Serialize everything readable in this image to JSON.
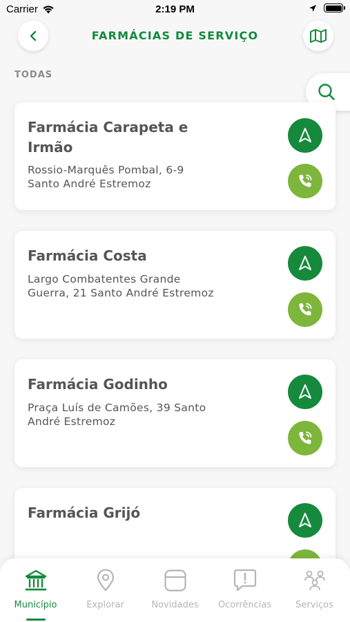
{
  "status_bar": {
    "carrier": "Carrier",
    "time": "2:19 PM"
  },
  "header": {
    "title": "FARMÁCIAS DE SERVIÇO"
  },
  "section": {
    "label": "TODAS"
  },
  "pharmacies": [
    {
      "name": "Farmácia Carapeta e Irmão",
      "address": "Rossio-Marquês Pombal, 6-9 Santo André Estremoz"
    },
    {
      "name": "Farmácia Costa",
      "address": "Largo Combatentes Grande Guerra, 21 Santo André Estremoz"
    },
    {
      "name": "Farmácia Godinho",
      "address": "Praça Luís de Camões, 39 Santo André Estremoz"
    },
    {
      "name": "Farmácia Grijó",
      "address": ""
    }
  ],
  "tabs": [
    {
      "label": "Município",
      "icon": "building-icon",
      "active": true
    },
    {
      "label": "Explorar",
      "icon": "location-pin-icon",
      "active": false
    },
    {
      "label": "Novidades",
      "icon": "news-icon",
      "active": false
    },
    {
      "label": "Ocorrências",
      "icon": "alert-bubble-icon",
      "active": false
    },
    {
      "label": "Serviços",
      "icon": "services-icon",
      "active": false
    }
  ],
  "colors": {
    "brand_green": "#128a3c",
    "nav_button": "#158a3d",
    "call_button": "#7db63a",
    "inactive": "#b5b5b5"
  }
}
